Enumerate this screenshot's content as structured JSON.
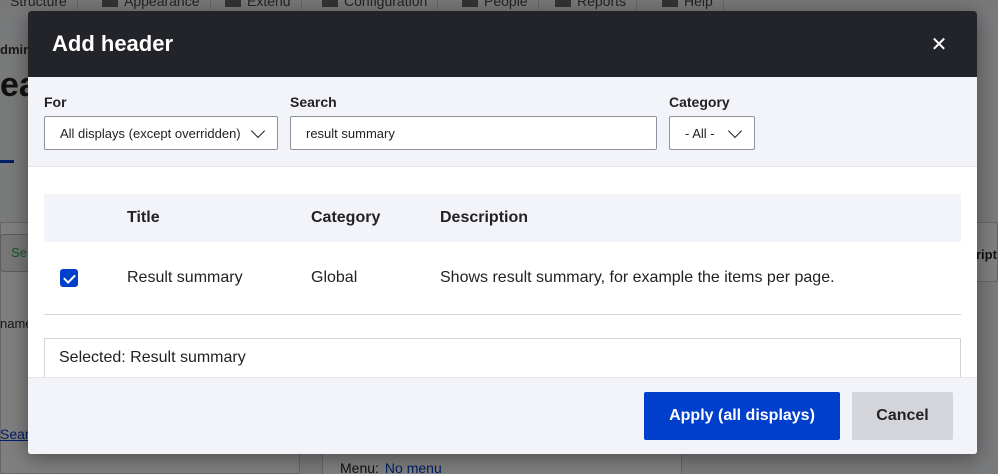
{
  "background": {
    "toolbar_tabs": [
      "Structure",
      "Appearance",
      "Extend",
      "Configuration",
      "People",
      "Reports",
      "Help"
    ],
    "admin_label": "dmin",
    "heading": "ea",
    "search_button_label": "Se",
    "name_label": "name",
    "search_link": "Sear",
    "right_label": "ripti",
    "menu_label": "Menu:",
    "menu_link": "No menu"
  },
  "dialog": {
    "title": "Add header",
    "close_icon": "close-icon",
    "filters": {
      "for_label": "For",
      "for_value": "All displays (except overridden)",
      "search_label": "Search",
      "search_value": "result summary",
      "category_label": "Category",
      "category_value": "- All -"
    },
    "table": {
      "headers": [
        "Title",
        "Category",
        "Description"
      ],
      "rows": [
        {
          "checked": true,
          "title": "Result summary",
          "category": "Global",
          "description": "Shows result summary, for example the items per page."
        }
      ]
    },
    "selected_text": "Selected: Result summary",
    "buttons": {
      "apply_label": "Apply (all displays)",
      "cancel_label": "Cancel"
    }
  },
  "colors": {
    "primary": "#003ecc",
    "header_bg": "#232429",
    "panel_bg": "#f3f4f9"
  }
}
